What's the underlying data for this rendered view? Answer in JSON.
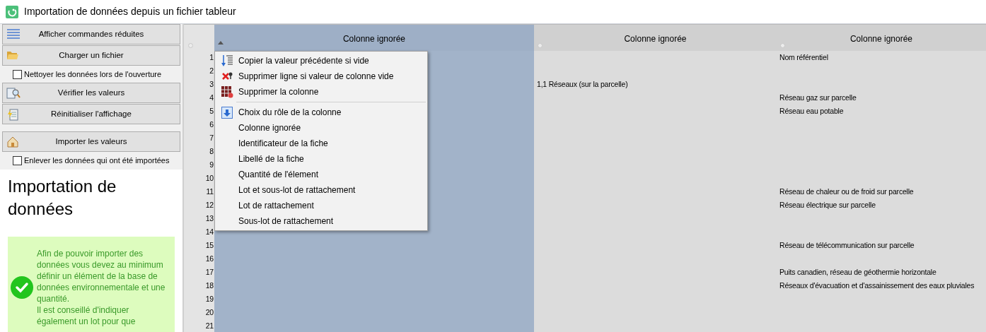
{
  "window": {
    "title": "Importation de données depuis un fichier tableur"
  },
  "sidebar": {
    "controls": [
      {
        "kind": "button",
        "label": "Afficher commandes réduites"
      },
      {
        "kind": "button",
        "label": "Charger un fichier"
      },
      {
        "kind": "checkbox",
        "label": "Nettoyer les données lors de l'ouverture",
        "checked": false
      },
      {
        "kind": "button",
        "label": "Vérifier les valeurs"
      },
      {
        "kind": "button",
        "label": "Réinitialiser l'affichage"
      },
      {
        "kind": "button",
        "label": "Importer les valeurs"
      },
      {
        "kind": "checkbox",
        "label": "Enlever les données qui ont été importées",
        "checked": false
      }
    ],
    "help": {
      "title": "Importation de données",
      "message": "Afin de pouvoir importer des données vous devez au minimum définir un élément de la base de données environnementale et une quantité.\nIl est conseillé d'indiquer également un lot pour que"
    }
  },
  "table": {
    "columns": [
      {
        "header": "Colonne ignorée",
        "selected": true
      },
      {
        "header": "Colonne ignorée",
        "selected": false
      },
      {
        "header": "Colonne ignorée",
        "selected": false
      }
    ],
    "rows": [
      {
        "number": "1",
        "cells": [
          "",
          "",
          "Nom référentiel"
        ]
      },
      {
        "number": "2",
        "cells": [
          "",
          "",
          ""
        ]
      },
      {
        "number": "3",
        "cells": [
          "",
          "1,1 Réseaux (sur la parcelle)",
          ""
        ]
      },
      {
        "number": "4",
        "cells": [
          "",
          "",
          "Réseau  gaz sur parcelle"
        ]
      },
      {
        "number": "5",
        "cells": [
          "",
          "",
          "Réseau eau potable"
        ]
      },
      {
        "number": "6",
        "cells": [
          "",
          "",
          ""
        ]
      },
      {
        "number": "7",
        "cells": [
          "",
          "",
          ""
        ]
      },
      {
        "number": "8",
        "cells": [
          "",
          "",
          ""
        ]
      },
      {
        "number": "9",
        "cells": [
          "",
          "",
          ""
        ]
      },
      {
        "number": "10",
        "cells": [
          "",
          "",
          ""
        ]
      },
      {
        "number": "11",
        "cells": [
          "",
          "",
          "Réseau de chaleur ou de froid sur parcelle"
        ]
      },
      {
        "number": "12",
        "cells": [
          "",
          "",
          "Réseau électrique sur parcelle"
        ]
      },
      {
        "number": "13",
        "cells": [
          "",
          "",
          ""
        ]
      },
      {
        "number": "14",
        "cells": [
          "",
          "",
          ""
        ]
      },
      {
        "number": "15",
        "cells": [
          "",
          "",
          "Réseau de télécommunication sur parcelle"
        ]
      },
      {
        "number": "16",
        "cells": [
          "",
          "",
          ""
        ]
      },
      {
        "number": "17",
        "cells": [
          "",
          "",
          "Puits canadien, réseau de géothermie horizontale"
        ]
      },
      {
        "number": "18",
        "cells": [
          "",
          "",
          "Réseaux d'évacuation et d'assainissement des eaux pluviales"
        ]
      },
      {
        "number": "19",
        "cells": [
          "",
          "",
          ""
        ]
      },
      {
        "number": "20",
        "cells": [
          "",
          "",
          ""
        ]
      },
      {
        "number": "21",
        "cells": [
          "",
          "",
          ""
        ]
      }
    ]
  },
  "context_menu": {
    "items": [
      {
        "kind": "action",
        "label": "Copier la valeur précédente si vide"
      },
      {
        "kind": "action",
        "label": "Supprimer ligne si valeur de colonne vide"
      },
      {
        "kind": "action",
        "label": "Supprimer la colonne"
      },
      {
        "kind": "separator"
      },
      {
        "kind": "action",
        "label": "Choix du rôle de la colonne"
      },
      {
        "kind": "option",
        "label": "Colonne ignorée"
      },
      {
        "kind": "option",
        "label": "Identificateur de la fiche"
      },
      {
        "kind": "option",
        "label": "Libellé de la fiche"
      },
      {
        "kind": "option",
        "label": "Quantité de l'élement"
      },
      {
        "kind": "option",
        "label": "Lot et sous-lot de rattachement"
      },
      {
        "kind": "option",
        "label": "Lot de rattachement"
      },
      {
        "kind": "option",
        "label": "Sous-lot de rattachement"
      }
    ]
  }
}
